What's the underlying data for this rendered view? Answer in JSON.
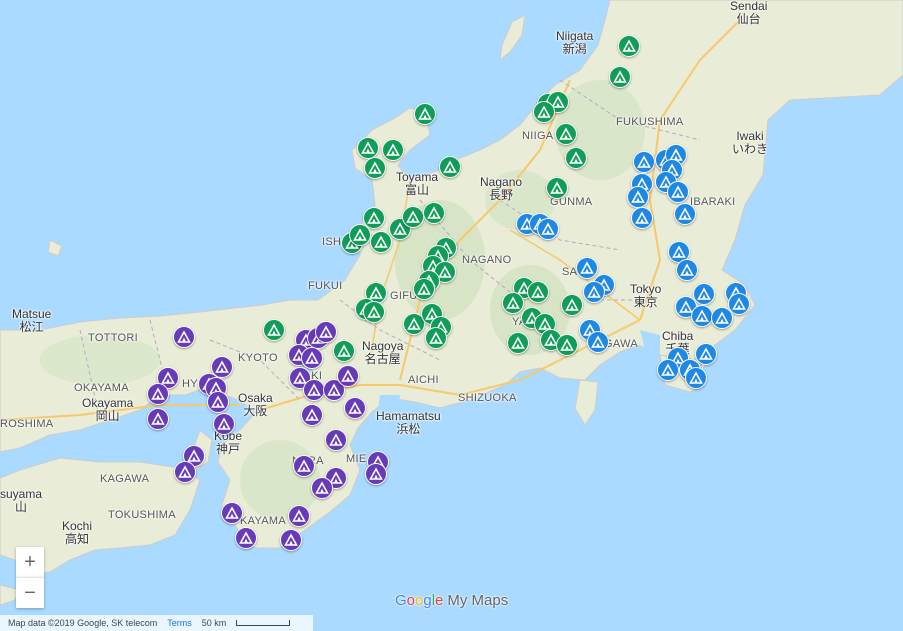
{
  "cities": [
    {
      "en": "Sendai",
      "jp": "仙台"
    },
    {
      "en": "Niigata",
      "jp": "新潟"
    },
    {
      "en": "Iwaki",
      "jp": "いわき"
    },
    {
      "en": "Toyama",
      "jp": "富山"
    },
    {
      "en": "Nagano",
      "jp": "長野"
    },
    {
      "en": "Tokyo",
      "jp": "東京"
    },
    {
      "en": "Chiba",
      "jp": "千葉"
    },
    {
      "en": "Nagoya",
      "jp": "名古屋"
    },
    {
      "en": "Hamamatsu",
      "jp": "浜松"
    },
    {
      "en": "Osaka",
      "jp": "大阪"
    },
    {
      "en": "Kobe",
      "jp": "神戸"
    },
    {
      "en": "Okayama",
      "jp": "岡山"
    },
    {
      "en": "Matsue",
      "jp": "松江"
    },
    {
      "en": "Kochi",
      "jp": "高知"
    },
    {
      "en": "suyama",
      "jp": "山"
    }
  ],
  "prefectures": [
    "FUKUSHIMA",
    "NIIGA",
    "GUNMA",
    "IBARAKI",
    "SAITA",
    "NAGANO",
    "ISHI",
    "FUKUI",
    "GIFU",
    "AICHI",
    "SHIZUOKA",
    "KYOTO",
    "HYO",
    "TOTTORI",
    "OKAYAMA",
    "ROSHIMA",
    "KAGAWA",
    "TOKUSHIMA",
    "MIE",
    "KAYAMA",
    "NARA",
    "SAKI",
    "YAMA",
    "GAWA"
  ],
  "marker_colors": {
    "green": "#0f9d58",
    "blue": "#1e88e5",
    "purple": "#673ab7"
  },
  "marker_icon": "campground-icon",
  "controls": {
    "zoom_in": "+",
    "zoom_out": "−"
  },
  "logo": {
    "g1": "G",
    "g2": "o",
    "g3": "o",
    "g4": "g",
    "g5": "l",
    "g6": "e",
    "product": "My Maps"
  },
  "attribution": {
    "text": "Map data ©2019 Google, SK telecom",
    "terms": "Terms",
    "scale": "50 km"
  }
}
